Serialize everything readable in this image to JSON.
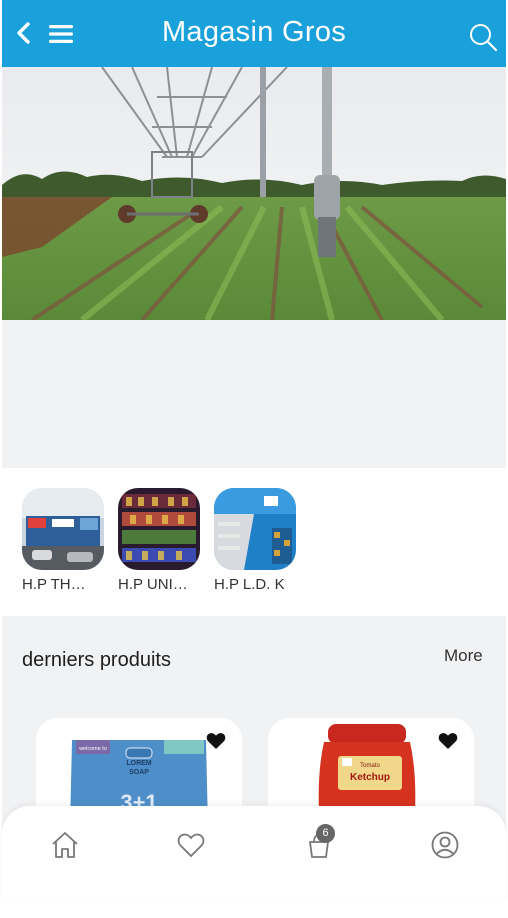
{
  "header": {
    "title": "Magasin Gros",
    "background": "#1aa1dc",
    "icons": [
      "back-arrow-icon",
      "menu-icon",
      "search-icon"
    ]
  },
  "stores": [
    {
      "label": "H.P TH…"
    },
    {
      "label": "H.P UNI…"
    },
    {
      "label": "H.P L.D. K"
    }
  ],
  "products": {
    "section_title": "derniers produits",
    "more_label": "More",
    "cards": [
      {
        "image_text_lines": [
          "welcome to",
          "LOREM",
          "SOAP",
          "3+1"
        ]
      },
      {
        "image_text_lines": [
          "Tomato",
          "Ketchup"
        ]
      }
    ]
  },
  "bottom_nav": {
    "items": [
      "home-icon",
      "heart-icon",
      "cart-icon",
      "account-icon"
    ],
    "cart_badge": "6"
  }
}
